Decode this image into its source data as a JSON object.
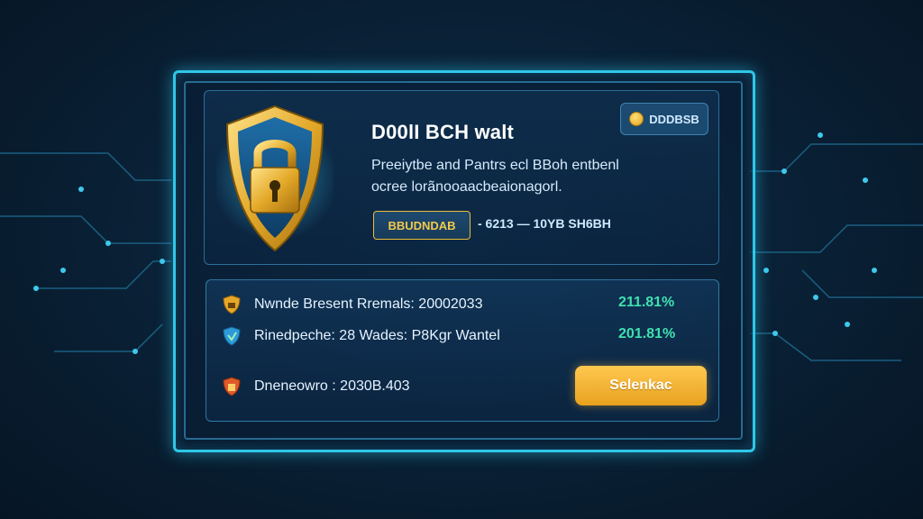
{
  "header": {
    "title": "D00lI BCH walt",
    "badge_label": "DDDBSB"
  },
  "description": {
    "line1": "Preeiytbe and Pantrs ecl BBoh entbenl",
    "line2": "ocree lorãnooaacbeaionagorl."
  },
  "cta": {
    "label": "BBUDNDAB",
    "range": "- 6213 — 10YB SH6BH"
  },
  "stats": [
    {
      "label": "Nwnde Bresent Rremals: 20002033",
      "value": "211.81%",
      "icon": "gold-shield-icon"
    },
    {
      "label": "Rinedpeche: 28 Wades: P8Kgr Wantel",
      "value": "201.81%",
      "icon": "blue-shield-icon"
    },
    {
      "label": "Dneneowro : 2030B.403",
      "value": "",
      "icon": "red-shield-icon"
    }
  ],
  "action_button": {
    "label": "Selenkac"
  },
  "colors": {
    "accent": "#2fc7e8",
    "gold": "#f2c94c",
    "positive": "#3fe0b0",
    "background": "#0a2238"
  }
}
